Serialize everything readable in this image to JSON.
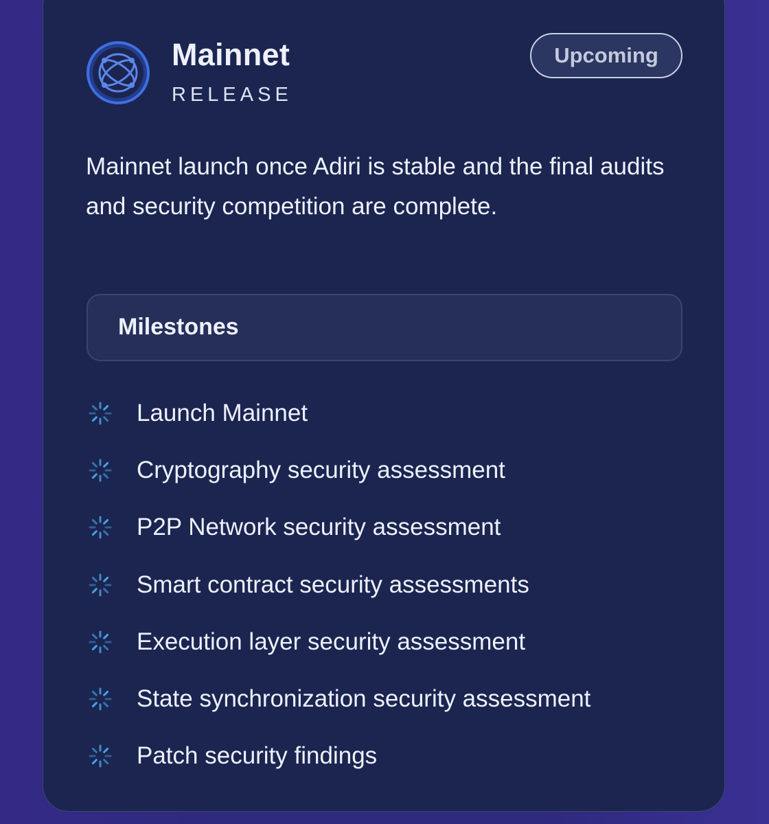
{
  "release": {
    "icon": "globe-network-icon",
    "title": "Mainnet",
    "subtitle": "RELEASE",
    "status": "Upcoming",
    "description": "Mainnet launch once Adiri is stable and the final audits and security competition are complete."
  },
  "milestones": {
    "heading": "Milestones",
    "icon": "loading-spinner-icon",
    "items": [
      {
        "label": "Launch Mainnet"
      },
      {
        "label": "Cryptography security assessment"
      },
      {
        "label": "P2P Network security assessment"
      },
      {
        "label": "Smart contract security assessments"
      },
      {
        "label": "Execution layer security assessment"
      },
      {
        "label": "State synchronization security assessment"
      },
      {
        "label": "Patch security findings"
      }
    ]
  },
  "colors": {
    "background": "#2e2a7e",
    "card": "#1b2550",
    "accent": "#3f6fe0",
    "spinner": "#4aa3e6",
    "text": "#eef1fb"
  }
}
